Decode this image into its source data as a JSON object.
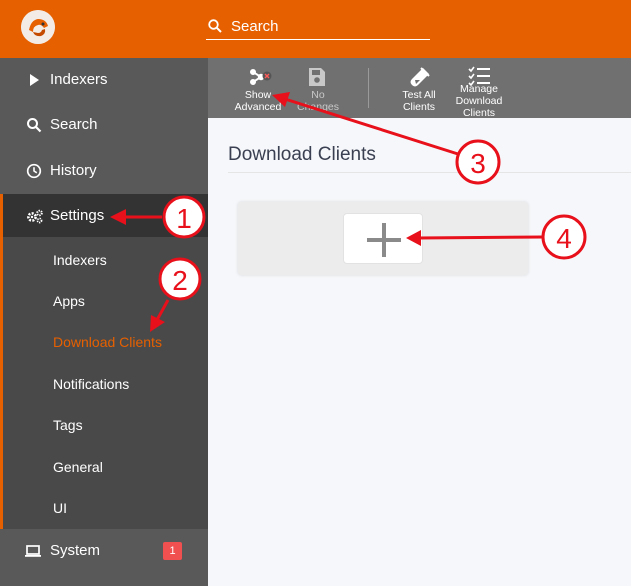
{
  "search": {
    "placeholder": "Search"
  },
  "sidebar": {
    "items": [
      {
        "label": "Indexers"
      },
      {
        "label": "Search"
      },
      {
        "label": "History"
      },
      {
        "label": "Settings"
      }
    ],
    "sub_items": [
      {
        "label": "Indexers"
      },
      {
        "label": "Apps"
      },
      {
        "label": "Download Clients"
      },
      {
        "label": "Notifications"
      },
      {
        "label": "Tags"
      },
      {
        "label": "General"
      },
      {
        "label": "UI"
      }
    ],
    "system": {
      "label": "System",
      "badge": "1"
    }
  },
  "toolbar": {
    "show_advanced": {
      "line1": "Show",
      "line2": "Advanced"
    },
    "no_changes": {
      "line1": "No",
      "line2": "Changes"
    },
    "test_all": {
      "line1": "Test All",
      "line2": "Clients"
    },
    "manage": {
      "line1": "Manage",
      "line2": "Download",
      "line3": "Clients"
    }
  },
  "page": {
    "title": "Download Clients"
  },
  "annotations": [
    "1",
    "2",
    "3",
    "4"
  ],
  "colors": {
    "accent": "#e66000",
    "annotation": "#e8101a",
    "sidebar": "#595959",
    "toolbar": "#707070",
    "badge": "#f05050"
  },
  "icons": [
    "search-icon",
    "play-icon",
    "clock-icon",
    "gears-icon",
    "laptop-icon",
    "advanced-icon",
    "save-icon",
    "test-tube-icon",
    "list-check-icon",
    "plus-icon"
  ]
}
